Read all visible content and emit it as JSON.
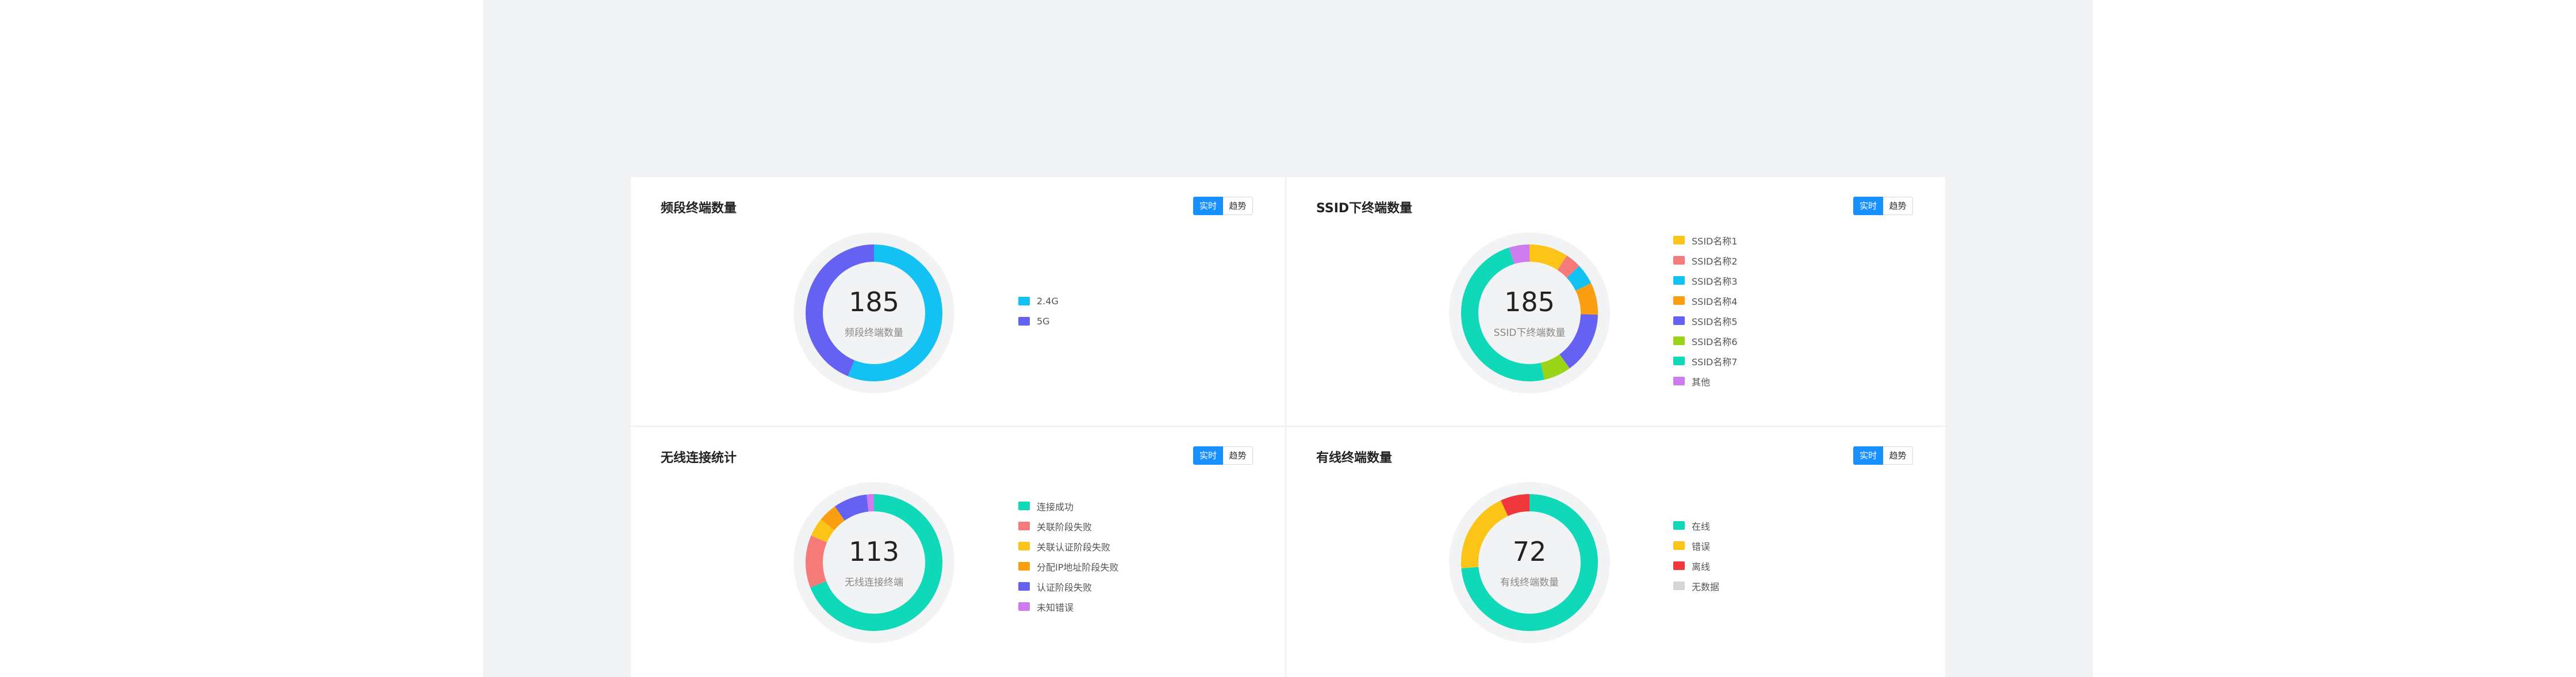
{
  "panels": [
    {
      "title": "频段终端数量",
      "toggle": {
        "realtime": "实时",
        "trend": "趋势",
        "active": "realtime"
      },
      "total": "185",
      "center_label": "频段终端数量",
      "legend": [
        {
          "label": "2.4G",
          "color": "#13c2f2"
        },
        {
          "label": "5G",
          "color": "#6461f3"
        }
      ]
    },
    {
      "title": "SSID下终端数量",
      "toggle": {
        "realtime": "实时",
        "trend": "趋势",
        "active": "realtime"
      },
      "total": "185",
      "center_label": "SSID下终端数量",
      "legend": [
        {
          "label": "SSID名称1",
          "color": "#fbc416"
        },
        {
          "label": "SSID名称2",
          "color": "#f77a7a"
        },
        {
          "label": "SSID名称3",
          "color": "#13c2f2"
        },
        {
          "label": "SSID名称4",
          "color": "#fa9e12"
        },
        {
          "label": "SSID名称5",
          "color": "#6461f3"
        },
        {
          "label": "SSID名称6",
          "color": "#9ad416"
        },
        {
          "label": "SSID名称7",
          "color": "#0fd9b9"
        },
        {
          "label": "其他",
          "color": "#cf7bf0"
        }
      ]
    },
    {
      "title": "无线连接统计",
      "toggle": {
        "realtime": "实时",
        "trend": "趋势",
        "active": "realtime"
      },
      "total": "113",
      "center_label": "无线连接终端",
      "legend": [
        {
          "label": "连接成功",
          "color": "#0fd9b9"
        },
        {
          "label": "关联阶段失败",
          "color": "#f77a7a"
        },
        {
          "label": "关联认证阶段失败",
          "color": "#fbc416"
        },
        {
          "label": "分配IP地址阶段失败",
          "color": "#fa9e12"
        },
        {
          "label": "认证阶段失败",
          "color": "#6461f3"
        },
        {
          "label": "未知错误",
          "color": "#cf7bf0"
        }
      ]
    },
    {
      "title": "有线终端数量",
      "toggle": {
        "realtime": "实时",
        "trend": "趋势",
        "active": "realtime"
      },
      "total": "72",
      "center_label": "有线终端数量",
      "legend": [
        {
          "label": "在线",
          "color": "#0fd9b9"
        },
        {
          "label": "错误",
          "color": "#fbc416"
        },
        {
          "label": "离线",
          "color": "#f0373c"
        },
        {
          "label": "无数据",
          "color": "#d6d6d6"
        }
      ]
    }
  ],
  "chart_data": [
    {
      "type": "pie",
      "categories": [
        "2.4G",
        "5G"
      ],
      "values": [
        104,
        81
      ]
    },
    {
      "type": "pie",
      "categories": [
        "SSID名称1",
        "SSID名称2",
        "SSID名称3",
        "SSID名称4",
        "SSID名称5",
        "SSID名称6",
        "SSID名称7",
        "其他"
      ],
      "values": [
        17,
        7,
        9,
        14,
        27,
        12,
        90,
        9
      ]
    },
    {
      "type": "pie",
      "categories": [
        "连接成功",
        "关联阶段失败",
        "关联认证阶段失败",
        "分配IP地址阶段失败",
        "认证阶段失败",
        "未知错误"
      ],
      "values": [
        78,
        14,
        5,
        5,
        9,
        2
      ]
    },
    {
      "type": "pie",
      "categories": [
        "在线",
        "错误",
        "离线",
        "无数据"
      ],
      "values": [
        53,
        14,
        5,
        0
      ]
    }
  ]
}
